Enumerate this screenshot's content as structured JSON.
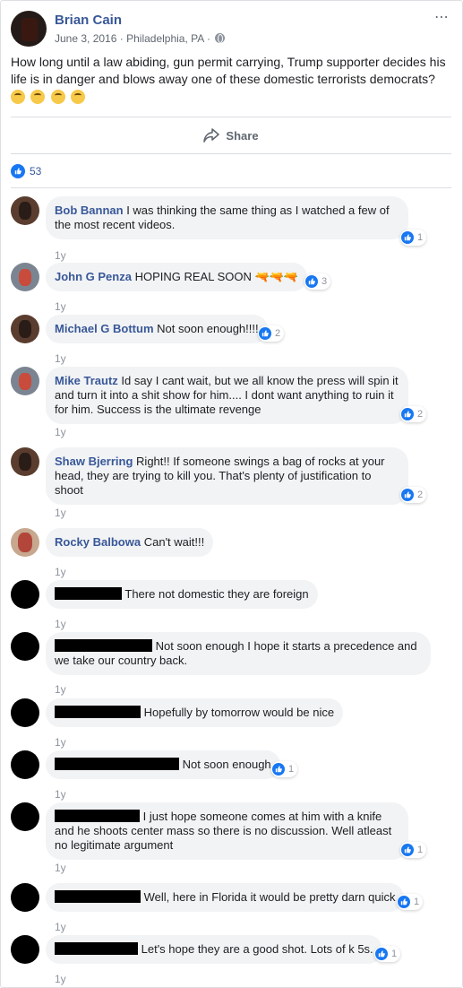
{
  "post": {
    "author": "Brian Cain",
    "date": "June 3, 2016",
    "location": "Philadelphia, PA",
    "meta_separator": "·",
    "more_icon": "⋯",
    "text": "How long until a law abiding, gun permit carrying, Trump supporter decides his life is in danger and blows away one of these domestic terrorists democrats?",
    "emoji_count": 4,
    "share_label": "Share",
    "likes": "53"
  },
  "colors": {
    "name_blue": "#385898",
    "like_blue": "#1877f2",
    "bubble": "#f2f3f5",
    "muted": "#606770"
  },
  "comments": [
    {
      "name": "Bob Bannan",
      "text": "I was thinking the same thing as I watched a few of the most recent videos.",
      "reactions": "1",
      "time": "1y"
    },
    {
      "name": "John G Penza",
      "text": "HOPING REAL SOON 🔫🔫🔫",
      "reactions": "3",
      "time": "1y"
    },
    {
      "name": "Michael G Bottum",
      "text": "Not soon enough!!!!",
      "reactions": "2",
      "time": "1y"
    },
    {
      "name": "Mike Trautz",
      "text": "Id say I cant wait, but we all know the press will spin it and turn it into a shit show for him.... I dont want anything to ruin it for him. Success is the ultimate revenge",
      "reactions": "2",
      "time": "1y"
    },
    {
      "name": "Shaw Bjerring",
      "text": "Right!! If someone swings a bag of rocks at your head, they are trying to kill you. That's plenty of justification to shoot",
      "reactions": "2",
      "time": "1y"
    },
    {
      "name": "Rocky Balbowa",
      "text": "Can't wait!!!",
      "reactions": "",
      "time": "1y"
    },
    {
      "name": "",
      "text": "There not domestic they are foreign",
      "reactions": "",
      "time": "1y"
    },
    {
      "name": "",
      "text": "Not soon enough I hope it starts a precedence and we take our country back.",
      "reactions": "",
      "time": "1y"
    },
    {
      "name": "",
      "text": "Hopefully by tomorrow would be nice",
      "reactions": "",
      "time": "1y"
    },
    {
      "name": "",
      "text": "Not soon enough",
      "reactions": "1",
      "time": "1y"
    },
    {
      "name": "",
      "text": "I just hope someone comes at him with a knife and he shoots center mass so there is no discussion. Well atleast no legitimate argument",
      "reactions": "1",
      "time": "1y"
    },
    {
      "name": "",
      "text": "Well, here in Florida it would be pretty darn quick",
      "reactions": "1",
      "time": "1y"
    },
    {
      "name": "",
      "text": "Let's hope they are a good shot. Lots of k 5s.",
      "reactions": "1",
      "time": "1y"
    }
  ]
}
